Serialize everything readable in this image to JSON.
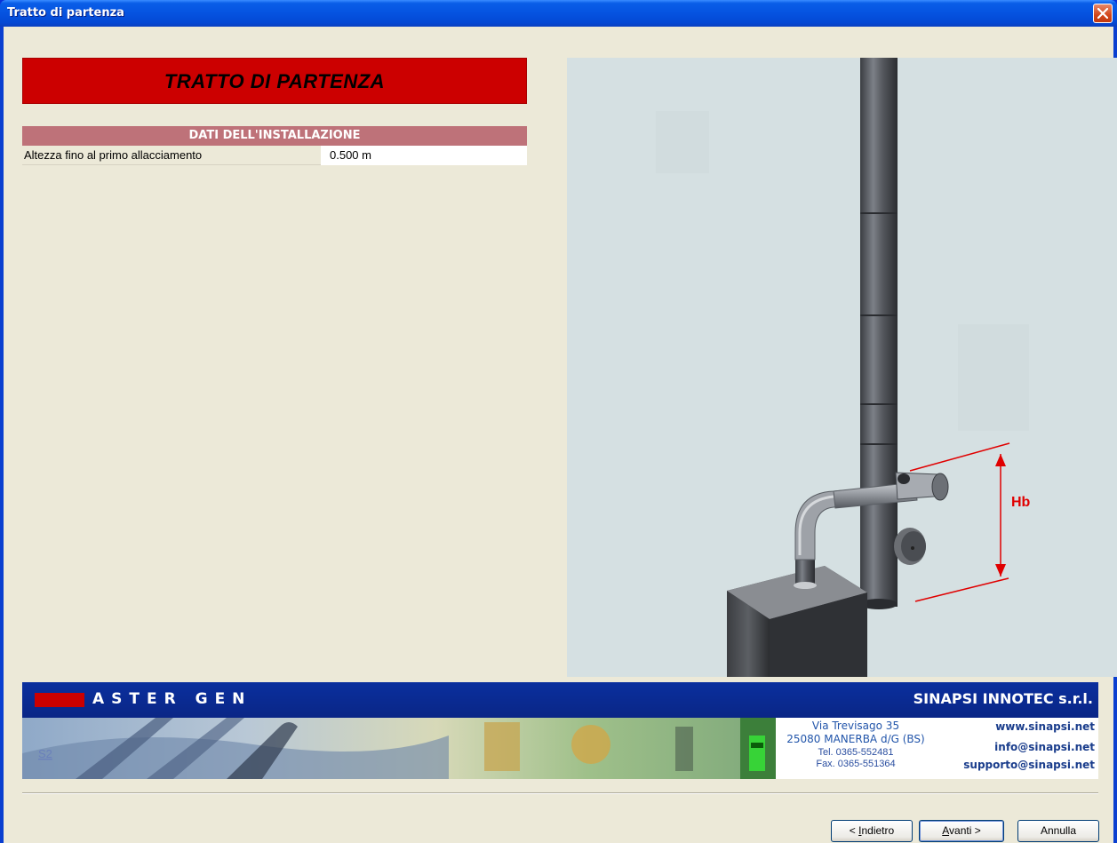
{
  "window": {
    "title": "Tratto di partenza"
  },
  "heading": "TRATTO DI PARTENZA",
  "section": {
    "title": "DATI DELL'INSTALLAZIONE",
    "rows": [
      {
        "label": "Altezza fino al primo allacciamento",
        "value": "0.500 m"
      }
    ]
  },
  "illustration": {
    "dimension_label": "Hb"
  },
  "banner": {
    "brand": "ASTER GEN",
    "company": "SINAPSI INNOTEC s.r.l.",
    "image_logo": "S2",
    "address_line1": "Via Trevisago 35",
    "address_line2": "25080 MANERBA d/G (BS)",
    "phone": "Tel. 0365-552481",
    "fax": "Fax. 0365-551364",
    "website": "www.sinapsi.net",
    "email_info": "info@sinapsi.net",
    "email_support": "supporto@sinapsi.net"
  },
  "buttons": {
    "back": {
      "mnemonic": "I",
      "rest": "ndietro",
      "prefix": "< ",
      "suffix": ""
    },
    "next": {
      "mnemonic": "A",
      "rest": "vanti",
      "prefix": "",
      "suffix": " >"
    },
    "cancel": "Annulla"
  },
  "colors": {
    "heading_bg": "#cc0000",
    "section_bg": "#be7279",
    "banner_bg": "#0a2a8a",
    "titlebar": "#0553e0"
  },
  "icons": {
    "close": "close-icon"
  }
}
